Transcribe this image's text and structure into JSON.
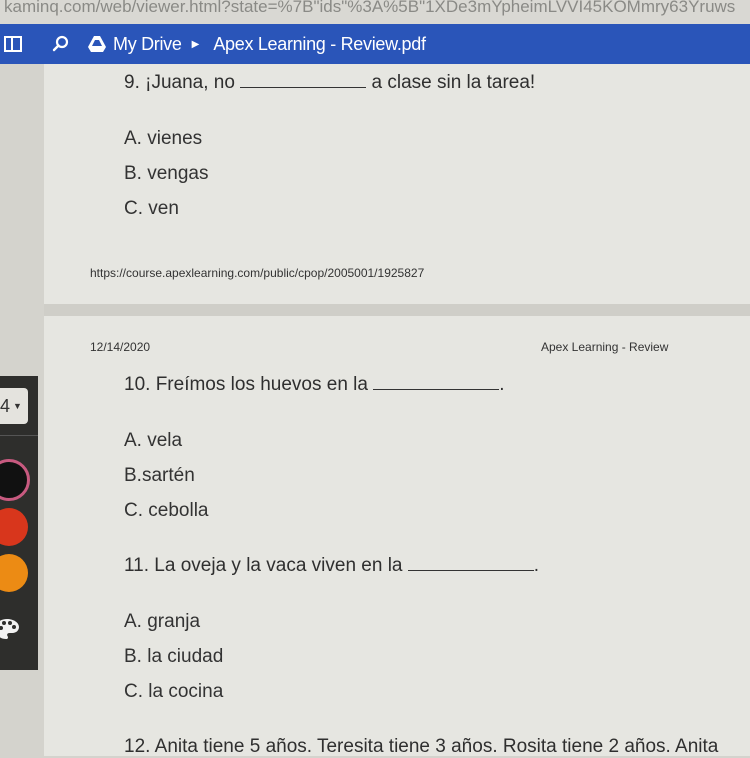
{
  "browser": {
    "url": "kaminq.com/web/viewer.html?state=%7B\"ids\"%3A%5B\"1XDe3mYpheimLVVI45KOMmry63Yruws"
  },
  "toolbar": {
    "breadcrumb_root": "My Drive",
    "file_name": "Apex Learning - Review.pdf",
    "icons": [
      "sidebar-toggle-icon",
      "search-icon",
      "google-drive-icon",
      "chevron-right-icon"
    ]
  },
  "document": {
    "page1": {
      "question": {
        "number": "9.",
        "before": "¡Juana, no",
        "after": "a clase sin la tarea!"
      },
      "options": [
        "A. vienes",
        "B. vengas",
        "C. ven"
      ],
      "footer_url": "https://course.apexlearning.com/public/cpop/2005001/1925827"
    },
    "page2": {
      "header_date": "12/14/2020",
      "header_title": "Apex Learning - Review",
      "questions": [
        {
          "number": "10.",
          "before": "Freímos los huevos en la",
          "after": ".",
          "options": [
            "A. vela",
            "B.sartén",
            "C. cebolla"
          ]
        },
        {
          "number": "11.",
          "before": "La oveja y la vaca viven en la",
          "after": ".",
          "options": [
            "A. granja",
            "B. la ciudad",
            "C. la cocina"
          ]
        },
        {
          "number": "12.",
          "text": "Anita tiene 5 años. Teresita tiene 3 años. Rosita tiene 2 años. Anita"
        }
      ]
    }
  },
  "tool_panel": {
    "pen_size": "4",
    "colors": [
      {
        "name": "black",
        "hex": "#111111",
        "selected": true
      },
      {
        "name": "red",
        "hex": "#d8361c",
        "selected": false
      },
      {
        "name": "orange",
        "hex": "#ec8b14",
        "selected": false
      }
    ]
  }
}
